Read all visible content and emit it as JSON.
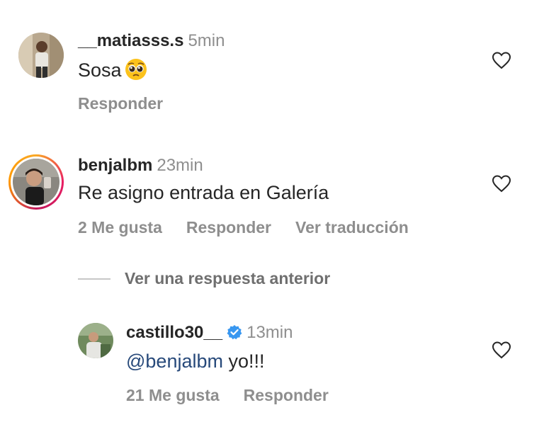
{
  "comments": [
    {
      "username": "__matiasss.s",
      "time": "5min",
      "text": "Sosa",
      "emoji": "pleading-face",
      "actions": {
        "reply": "Responder"
      }
    },
    {
      "username": "benjalbm",
      "time": "23min",
      "text": "Re asigno entrada en Galería",
      "actions": {
        "likes": "2 Me gusta",
        "reply": "Responder",
        "translate": "Ver traducción"
      }
    }
  ],
  "view_previous": "Ver una respuesta anterior",
  "reply": {
    "username": "castillo30__",
    "verified": true,
    "time": "13min",
    "mention": "@benjalbm",
    "text": " yo!!!",
    "actions": {
      "likes": "21 Me gusta",
      "reply": "Responder"
    }
  },
  "colors": {
    "text": "#262626",
    "secondary": "#8e8e8e",
    "mention": "#27497a",
    "verified": "#3897f0"
  }
}
